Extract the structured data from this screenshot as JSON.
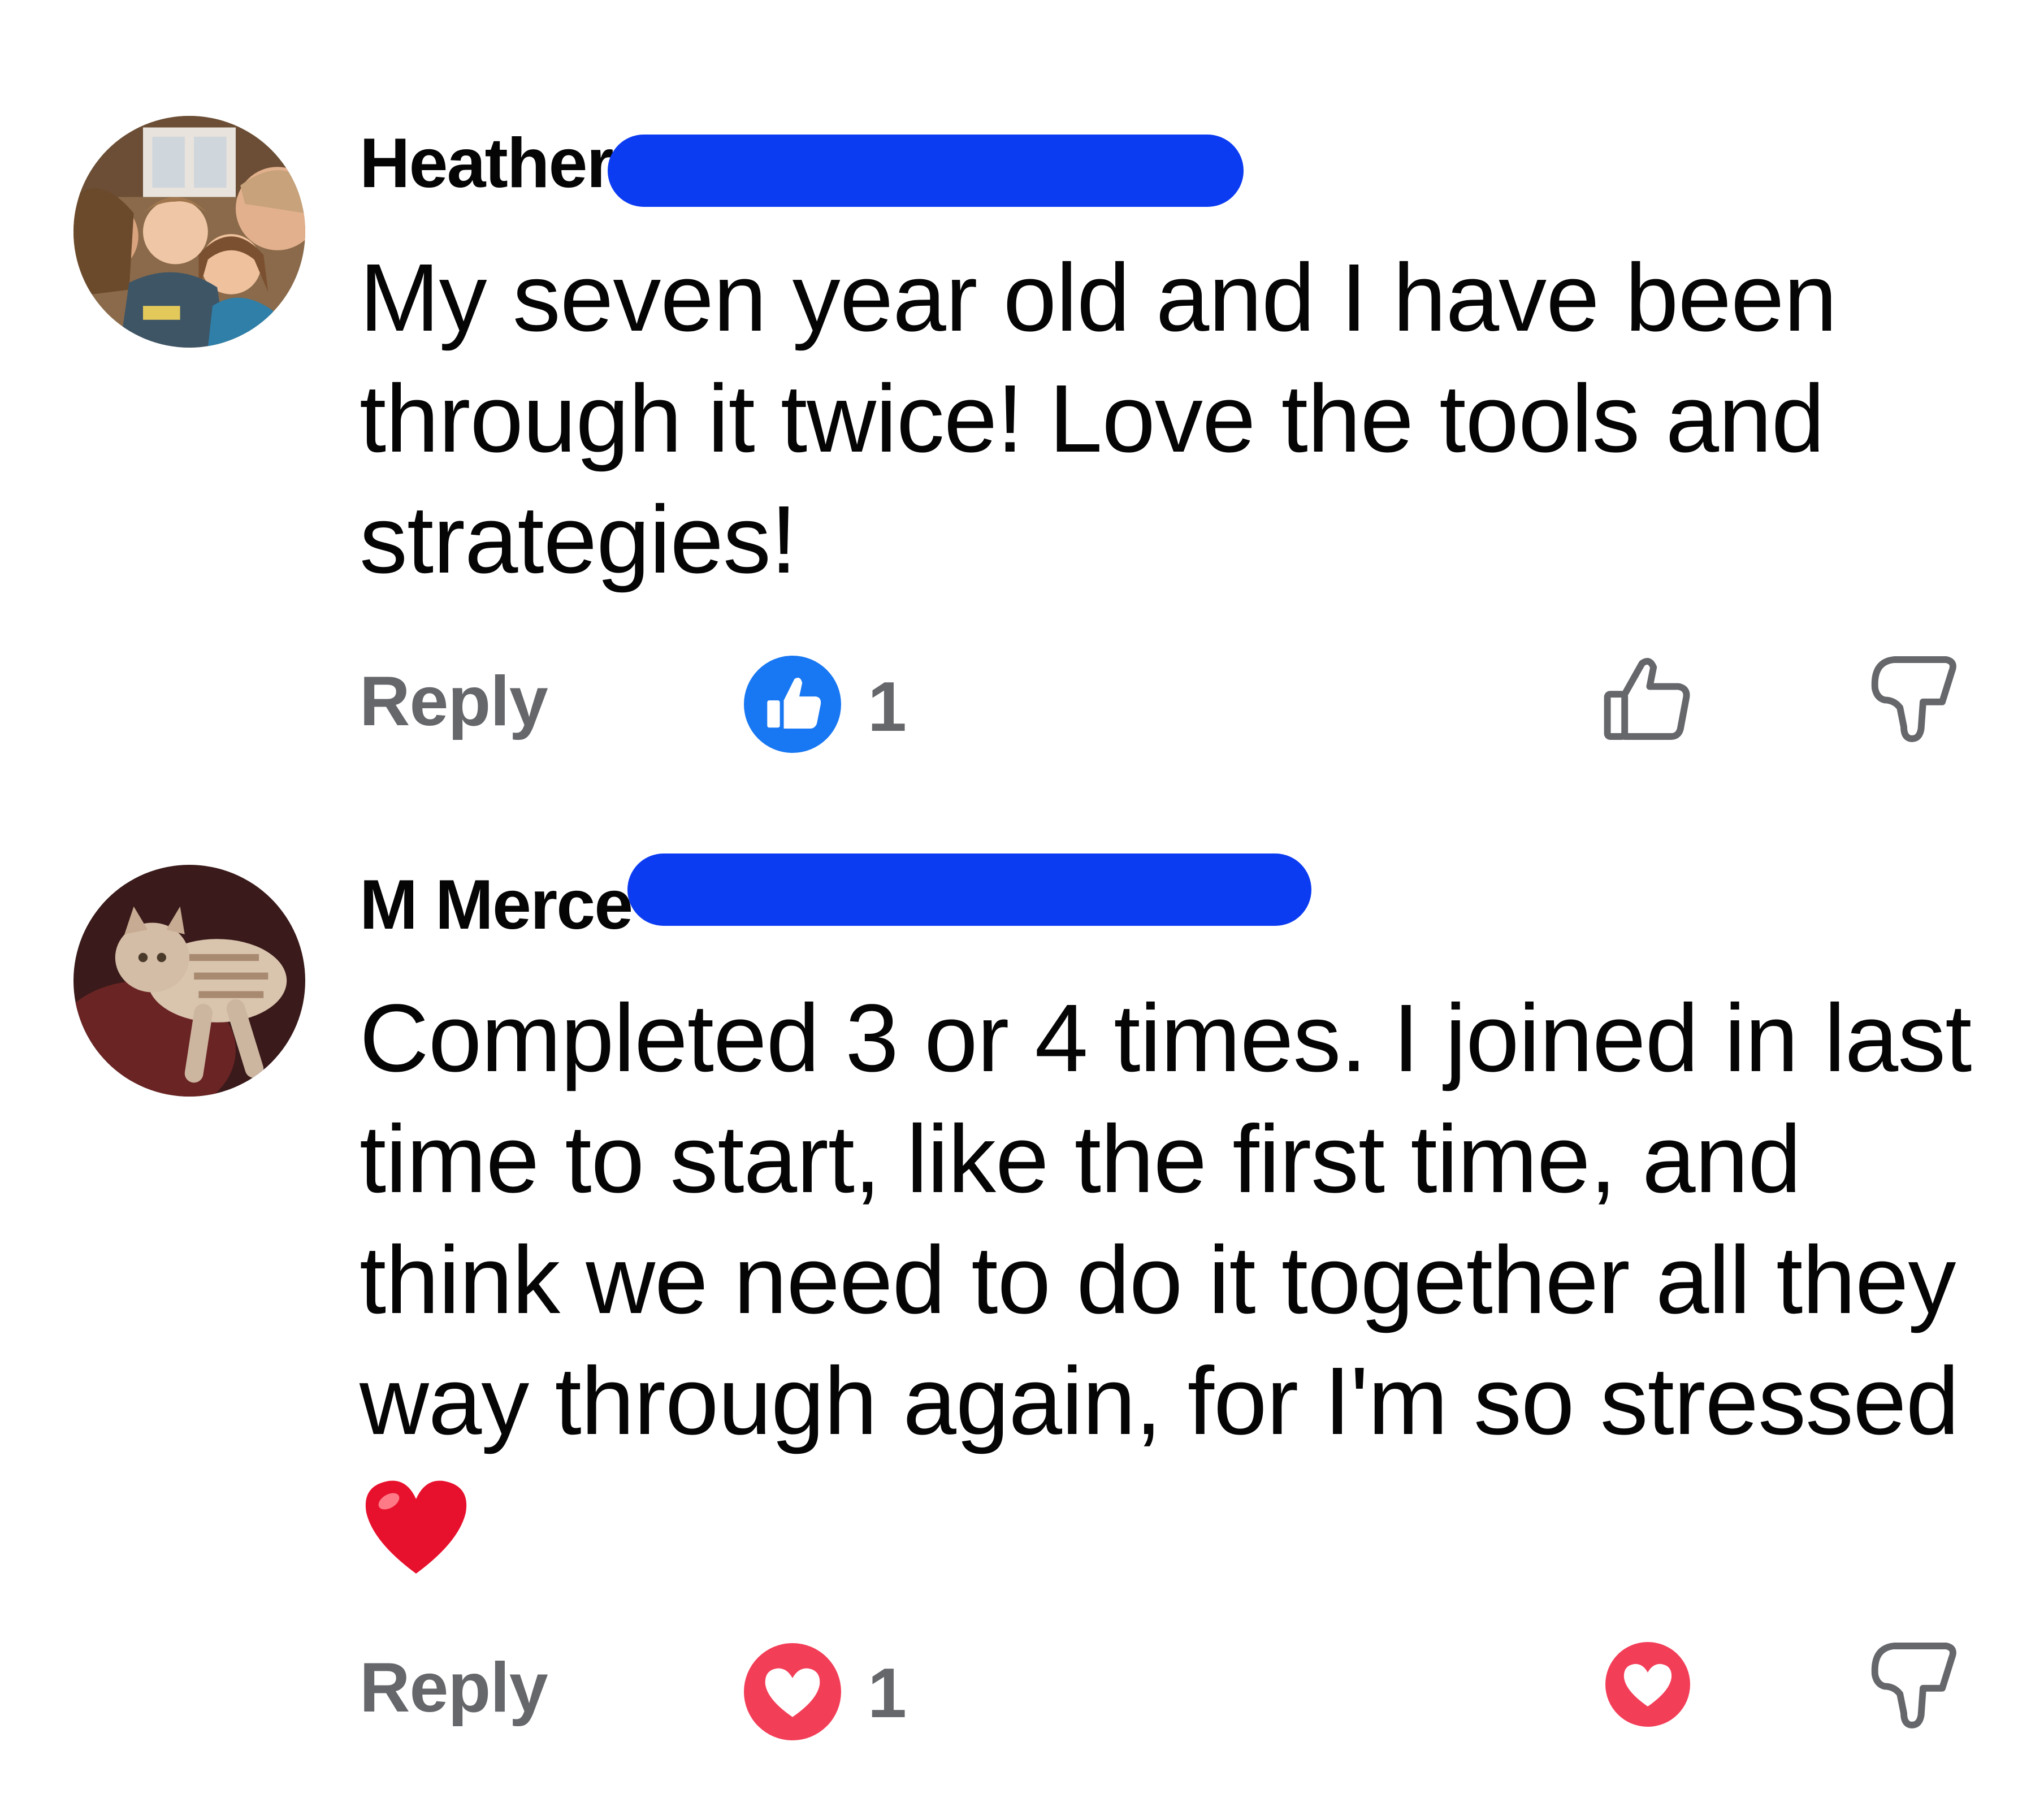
{
  "comments": [
    {
      "author": "Heather",
      "text": "My seven year old and I have been through it twice!  Love the tools and strategies!",
      "reply_label": "Reply",
      "reaction_type": "like",
      "reaction_count": "1"
    },
    {
      "author": "M Merce",
      "text": "Completed 3 or 4 times. I joined in last time to start, like the first time, and think we need to do it together all they way through again, for I'm so stressed",
      "emoji": "heart",
      "reply_label": "Reply",
      "reaction_type": "love",
      "reaction_count": "1"
    }
  ],
  "colors": {
    "like_blue": "#1877f2",
    "love_red": "#f33e58",
    "redaction_blue": "#0c3cf2",
    "muted_text": "#65676b"
  }
}
